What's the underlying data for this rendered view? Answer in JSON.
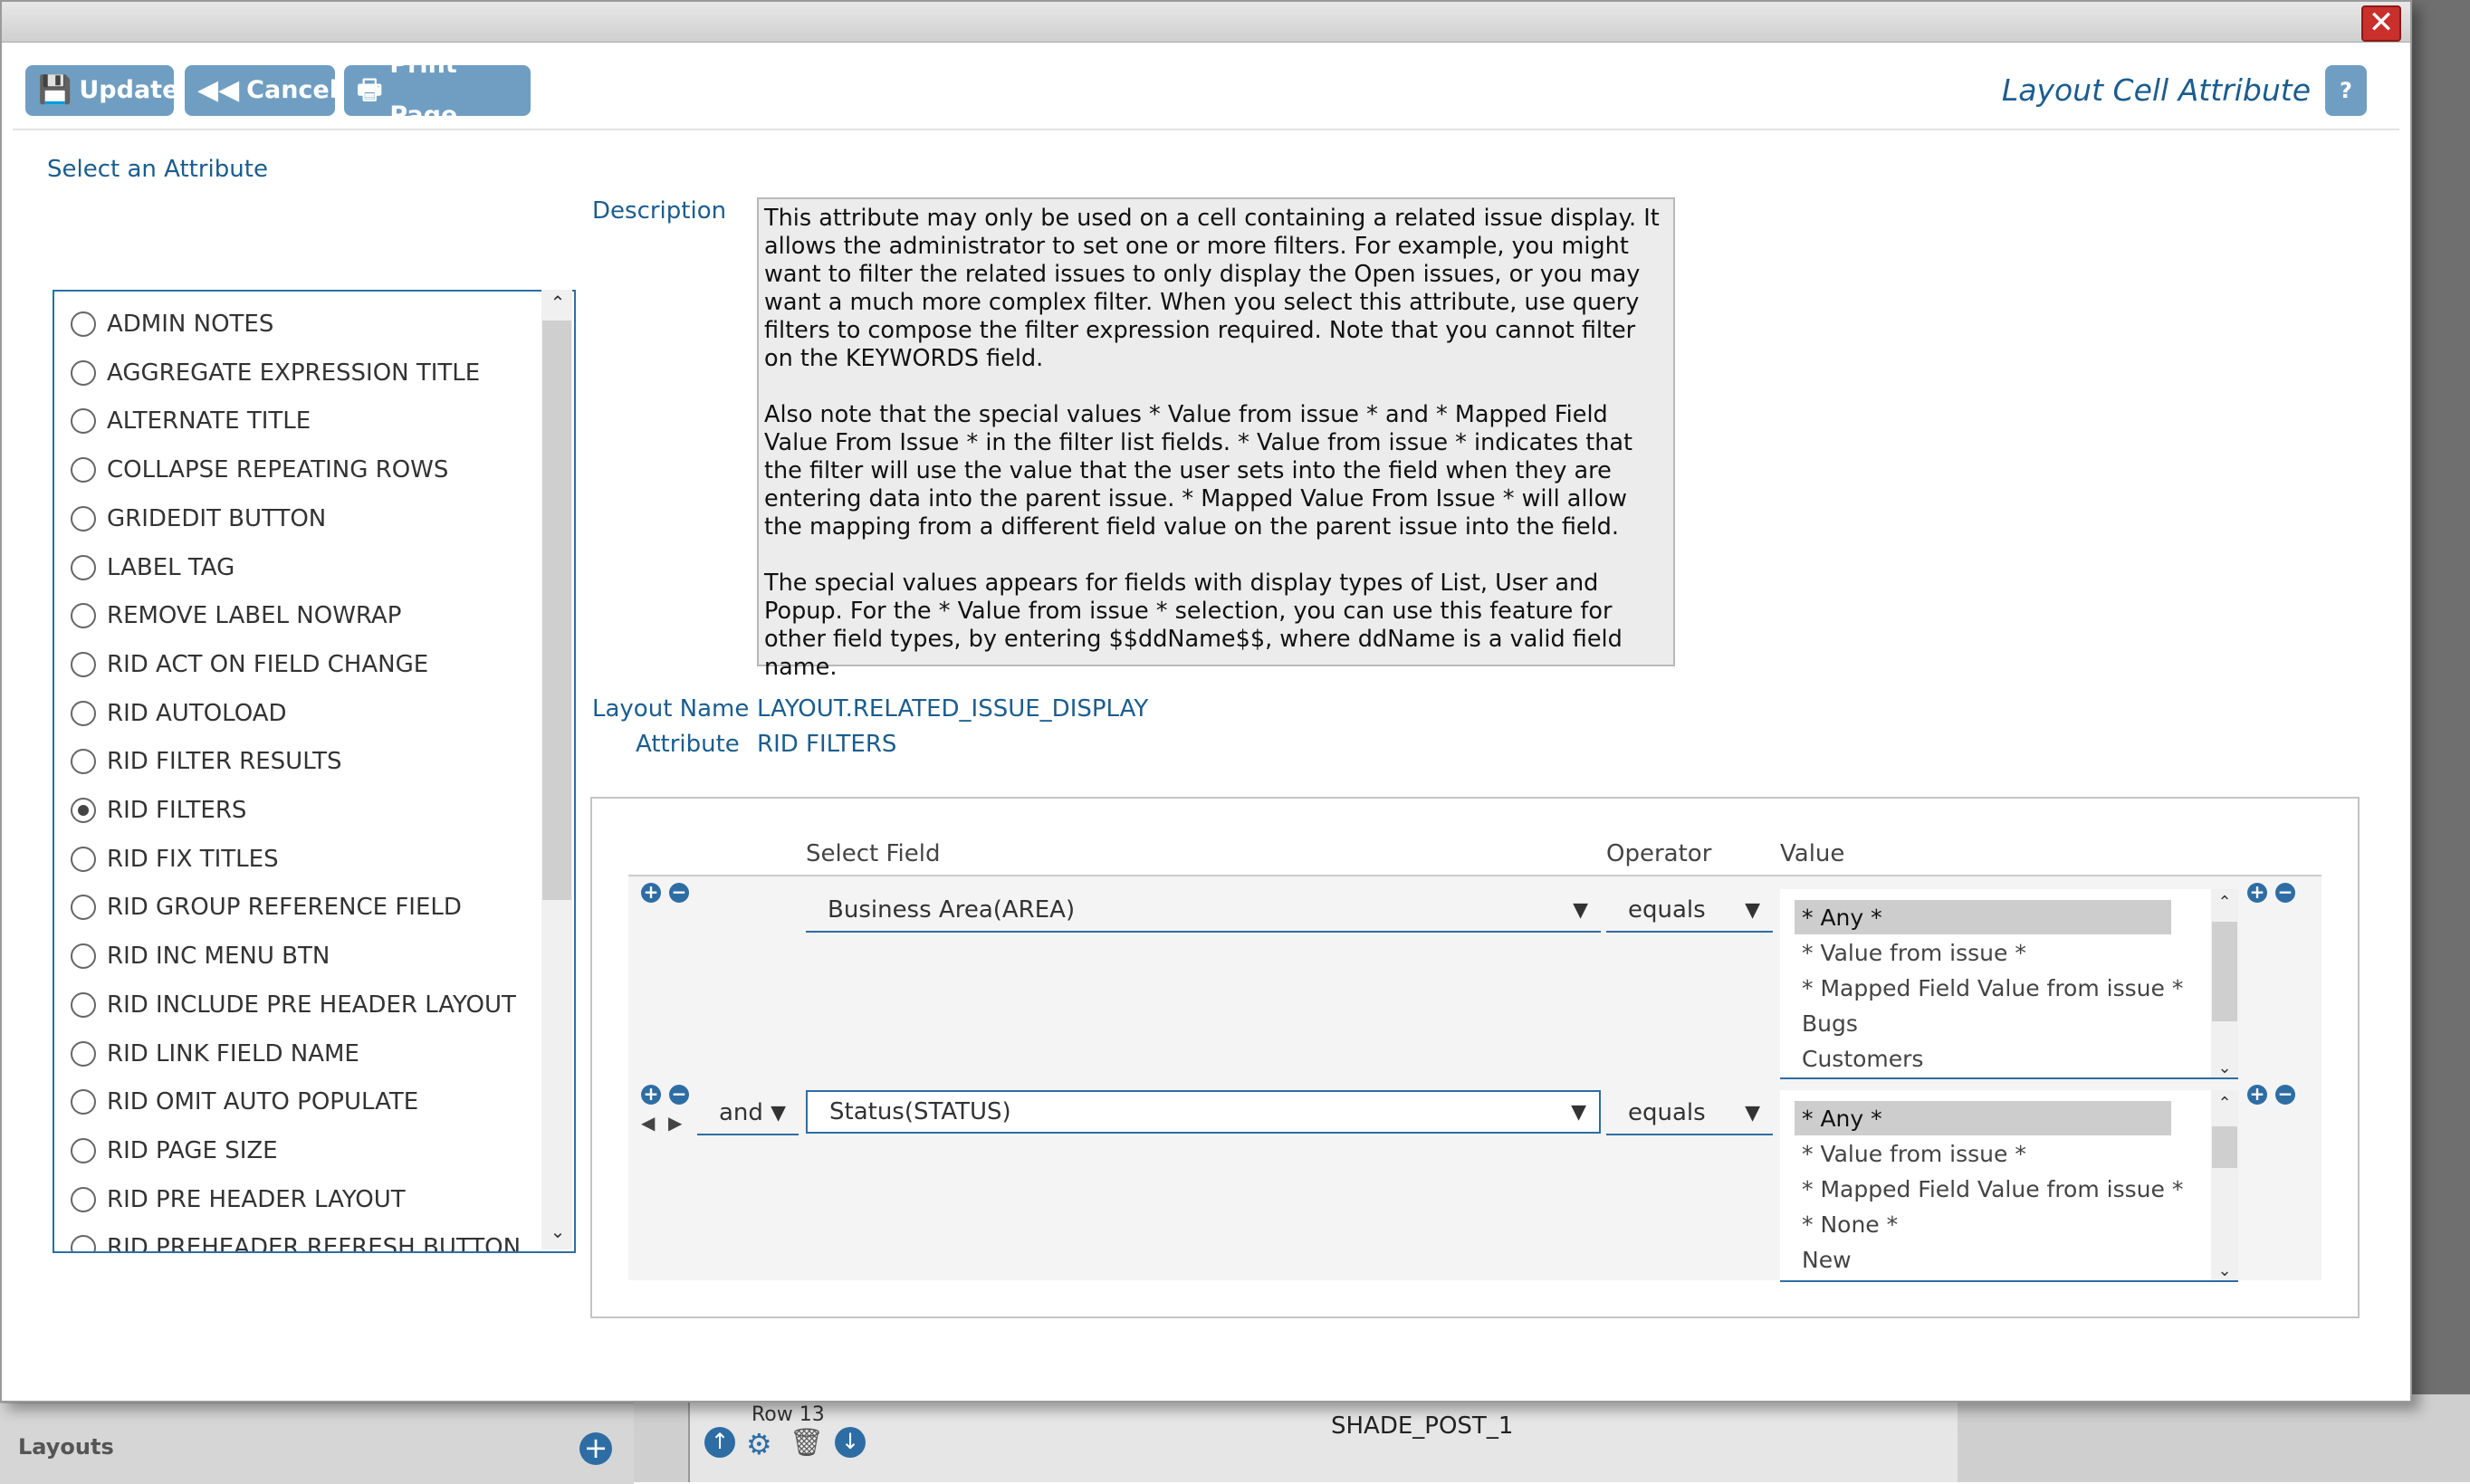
{
  "toolbar": {
    "update_label": "Update",
    "cancel_label": "Cancel",
    "print_label": "Print Page",
    "title": "Layout Cell Attribute",
    "help_label": "?",
    "close_label": "✕"
  },
  "left": {
    "heading": "Select an Attribute",
    "attributes": [
      {
        "label": "ADMIN NOTES",
        "selected": false
      },
      {
        "label": "AGGREGATE EXPRESSION TITLE",
        "selected": false
      },
      {
        "label": "ALTERNATE TITLE",
        "selected": false
      },
      {
        "label": "COLLAPSE REPEATING ROWS",
        "selected": false
      },
      {
        "label": "GRIDEDIT BUTTON",
        "selected": false
      },
      {
        "label": "LABEL TAG",
        "selected": false
      },
      {
        "label": "REMOVE LABEL NOWRAP",
        "selected": false
      },
      {
        "label": "RID ACT ON FIELD CHANGE",
        "selected": false
      },
      {
        "label": "RID AUTOLOAD",
        "selected": false
      },
      {
        "label": "RID FILTER RESULTS",
        "selected": false
      },
      {
        "label": "RID FILTERS",
        "selected": true
      },
      {
        "label": "RID FIX TITLES",
        "selected": false
      },
      {
        "label": "RID GROUP REFERENCE FIELD",
        "selected": false
      },
      {
        "label": "RID INC MENU BTN",
        "selected": false
      },
      {
        "label": "RID INCLUDE PRE HEADER LAYOUT",
        "selected": false
      },
      {
        "label": "RID LINK FIELD NAME",
        "selected": false
      },
      {
        "label": "RID OMIT AUTO POPULATE",
        "selected": false
      },
      {
        "label": "RID PAGE SIZE",
        "selected": false
      },
      {
        "label": "RID PRE HEADER LAYOUT",
        "selected": false
      },
      {
        "label": "RID PREHEADER REFRESH BUTTON",
        "selected": false
      }
    ]
  },
  "description": {
    "label": "Description",
    "p1": "This attribute may only be used on a cell containing a related issue display. It allows the administrator to set one or more filters. For example, you might want to filter the related issues to only display the Open issues, or you may want a much more complex filter. When you select this attribute, use query filters to compose the filter expression required. Note that you cannot filter on the KEYWORDS field.",
    "p2": "Also note that the special values * Value from issue * and * Mapped Field Value From Issue * in the filter list fields. * Value from issue * indicates that the filter will use the value that the user sets into the field when they are entering data into the parent issue. * Mapped Value From Issue * will allow the mapping from a different field value on the parent issue into the field.",
    "p3": "The special values appears for fields with display types of List, User and Popup. For the * Value from issue * selection, you can use this feature for other field types, by entering $$ddName$$, where ddName is a valid field name."
  },
  "meta": {
    "layout_name_label": "Layout Name",
    "layout_name_value": "LAYOUT.RELATED_ISSUE_DISPLAY",
    "attribute_label": "Attribute",
    "attribute_value": "RID FILTERS"
  },
  "filters": {
    "col_field": "Select Field",
    "col_operator": "Operator",
    "col_value": "Value",
    "rows": [
      {
        "connector": "",
        "field": "Business Area(AREA)",
        "operator": "equals",
        "values": [
          "* Any *",
          "* Value from issue *",
          "* Mapped Field Value from issue *",
          "Bugs",
          "Customers"
        ],
        "selected_value": "* Any *"
      },
      {
        "connector": "and",
        "field": "Status(STATUS)",
        "operator": "equals",
        "values": [
          "* Any *",
          "* Value from issue *",
          "* Mapped Field Value from issue *",
          "* None *",
          "New"
        ],
        "selected_value": "* Any *"
      }
    ]
  },
  "background": {
    "row_label": "Row 13",
    "cell_label": "SHADE_POST_1",
    "panel_label": "Layouts"
  },
  "colors": {
    "accent": "#2e6da4",
    "button": "#6f9ec2",
    "title": "#1b5d8f",
    "close": "#c9302c"
  }
}
